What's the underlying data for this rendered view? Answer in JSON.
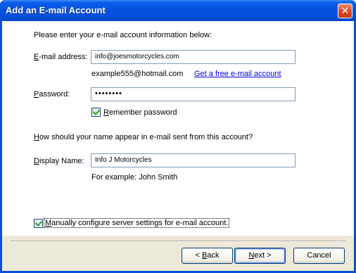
{
  "window": {
    "title": "Add an E-mail Account"
  },
  "intro": "Please enter your e-mail account information below:",
  "email": {
    "label_prefix": "E",
    "label_rest": "-mail address:",
    "value": "info@joesmotorcycles.com",
    "example": "example555@hotmail.com",
    "free_link": "Get a free e-mail account"
  },
  "password": {
    "label_prefix": "P",
    "label_rest": "assword:",
    "masked": "••••••••"
  },
  "remember": {
    "prefix": "R",
    "rest": "emember password",
    "checked": true
  },
  "name_question": {
    "prefix": "H",
    "rest": "ow should your name appear in e-mail sent from this account?"
  },
  "display": {
    "label_prefix": "D",
    "label_rest": "isplay Name:",
    "value": "Info J Motorcycles",
    "example": "For example: John Smith"
  },
  "manual": {
    "prefix": "M",
    "rest": "anually configure server settings for e-mail account.",
    "checked": true
  },
  "buttons": {
    "back_prefix": "< ",
    "back_key": "B",
    "back_rest": "ack",
    "next_key": "N",
    "next_rest": "ext >",
    "cancel": "Cancel"
  }
}
